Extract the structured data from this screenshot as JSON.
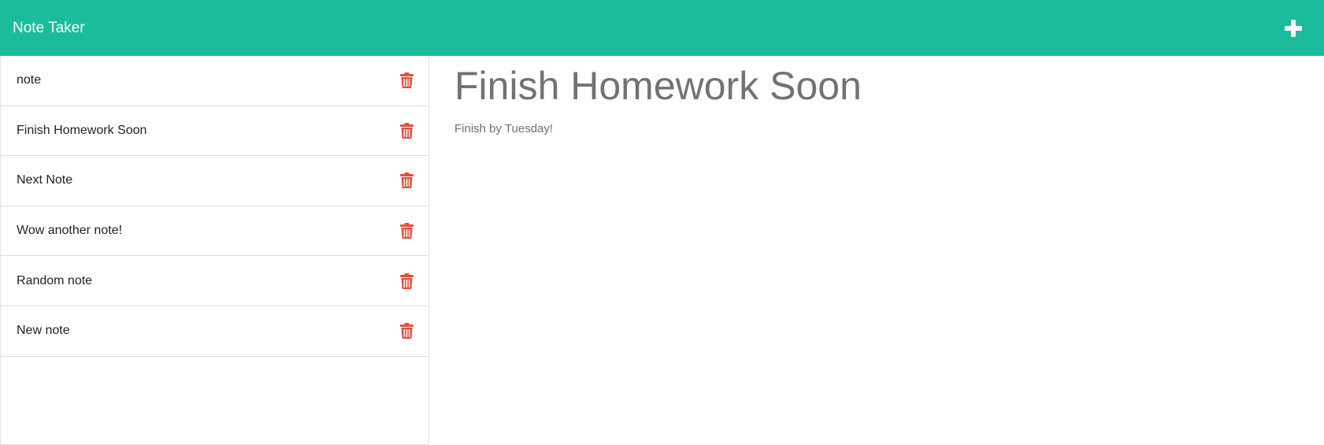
{
  "colors": {
    "navbar_bg": "#1abc9c",
    "trash": "#e74c3c",
    "brand_text": "#ffffff"
  },
  "navbar": {
    "brand": "Note Taker",
    "add_icon": "plus-icon"
  },
  "sidebar": {
    "notes": [
      {
        "title": "note",
        "icon": "trash-icon"
      },
      {
        "title": "Finish Homework Soon",
        "icon": "trash-icon"
      },
      {
        "title": "Next Note",
        "icon": "trash-icon"
      },
      {
        "title": "Wow another note!",
        "icon": "trash-icon"
      },
      {
        "title": "Random note",
        "icon": "trash-icon"
      },
      {
        "title": "New note",
        "icon": "trash-icon"
      }
    ]
  },
  "main": {
    "title": "Finish Homework Soon",
    "text": "Finish by Tuesday!"
  }
}
